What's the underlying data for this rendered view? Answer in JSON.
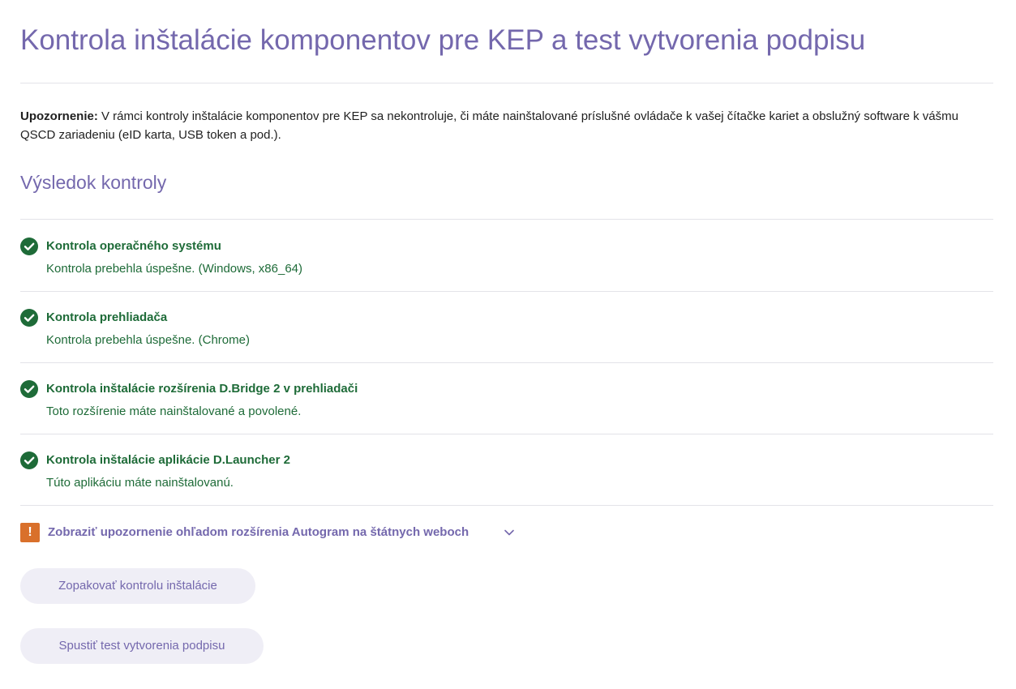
{
  "page": {
    "title": "Kontrola inštalácie komponentov pre KEP a test vytvorenia podpisu"
  },
  "notice": {
    "label": "Upozornenie:",
    "text": " V rámci kontroly inštalácie komponentov pre KEP sa nekontroluje, či máte nainštalované príslušné ovládače k vašej čítačke kariet a obslužný software k vášmu QSCD zariadeniu (eID karta, USB token a pod.)."
  },
  "results": {
    "heading": "Výsledok kontroly",
    "status_color": "#1e6b38",
    "items": [
      {
        "icon": "check-circle-icon",
        "title": "Kontrola operačného systému",
        "description": "Kontrola prebehla úspešne. (Windows, x86_64)"
      },
      {
        "icon": "check-circle-icon",
        "title": "Kontrola prehliadača",
        "description": "Kontrola prebehla úspešne. (Chrome)"
      },
      {
        "icon": "check-circle-icon",
        "title": "Kontrola inštalácie rozšírenia D.Bridge 2 v prehliadači",
        "description": "Toto rozšírenie máte nainštalované a povolené."
      },
      {
        "icon": "check-circle-icon",
        "title": "Kontrola inštalácie aplikácie D.Launcher 2",
        "description": "Túto aplikáciu máte nainštalovanú."
      }
    ]
  },
  "warning": {
    "icon_glyph": "!",
    "icon_color": "#d9702b",
    "label": "Zobraziť upozornenie ohľadom rozšírenia Autogram na štátnych weboch"
  },
  "buttons": {
    "repeat_check": "Zopakovať kontrolu inštalácie",
    "run_signature_test": "Spustiť test vytvorenia podpisu"
  },
  "theme": {
    "accent": "#7468ad",
    "button_bg": "#efeef6"
  }
}
